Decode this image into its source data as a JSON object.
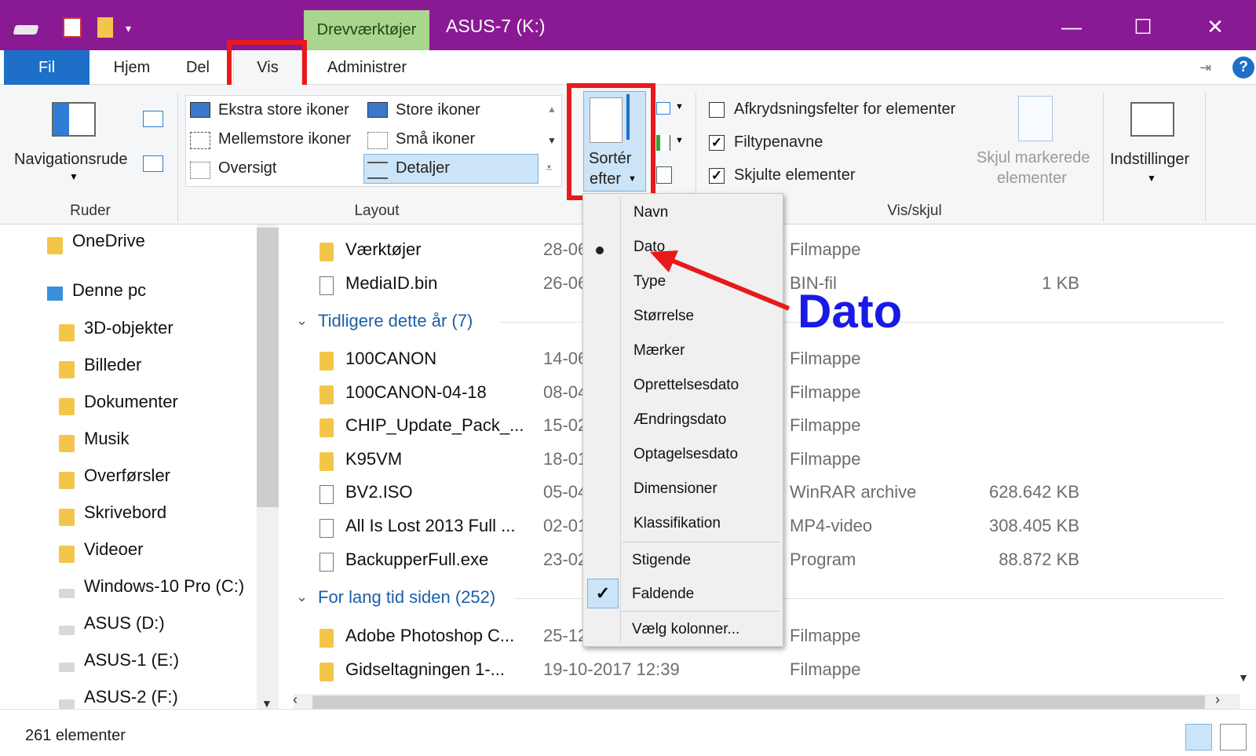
{
  "titlebar": {
    "title": "ASUS-7 (K:)",
    "context_tab": "Drevværktøjer",
    "minimize": "—",
    "maximize": "☐",
    "close": "✕",
    "accent": "#8a1a94"
  },
  "tabs": [
    "Fil",
    "Hjem",
    "Del",
    "Vis",
    "Administrer"
  ],
  "ribbon": {
    "ruder": {
      "nav_pane": "Navigationsrude",
      "group": "Ruder"
    },
    "layout": {
      "options": [
        "Ekstra store ikoner",
        "Store ikoner",
        "Mellemstore ikoner",
        "Små ikoner",
        "Oversigt",
        "Detaljer"
      ],
      "selected": "Detaljer",
      "group": "Layout"
    },
    "sort": {
      "line1": "Sortér",
      "line2": "efter"
    },
    "visskjul": {
      "checkboxes": [
        {
          "label": "Afkrydsningsfelter for elementer",
          "checked": false
        },
        {
          "label": "Filtypenavne",
          "checked": true
        },
        {
          "label": "Skjulte elementer",
          "checked": true
        }
      ],
      "hide_selected_1": "Skjul markerede",
      "hide_selected_2": "elementer",
      "group": "Vis/skjul"
    },
    "settings": "Indstillinger"
  },
  "nav": {
    "items": [
      "OneDrive",
      "Denne pc",
      "3D-objekter",
      "Billeder",
      "Dokumenter",
      "Musik",
      "Overførsler",
      "Skrivebord",
      "Videoer",
      "Windows-10 Pro (C:)",
      "ASUS (D:)",
      "ASUS-1 (E:)",
      "ASUS-2 (F:)"
    ]
  },
  "files": {
    "top_rows": [
      {
        "name": "Værktøjer",
        "date": "28-06",
        "type": "Filmappe",
        "size": ""
      },
      {
        "name": "MediaID.bin",
        "date": "26-06",
        "type": "BIN-fil",
        "size": "1 KB"
      }
    ],
    "group1": "Tidligere dette år (7)",
    "group1_rows": [
      {
        "name": "100CANON",
        "date": "14-06",
        "type": "Filmappe",
        "size": ""
      },
      {
        "name": "100CANON-04-18",
        "date": "08-04",
        "type": "Filmappe",
        "size": ""
      },
      {
        "name": "CHIP_Update_Pack_...",
        "date": "15-02",
        "type": "Filmappe",
        "size": ""
      },
      {
        "name": "K95VM",
        "date": "18-01",
        "type": "Filmappe",
        "size": ""
      },
      {
        "name": "BV2.ISO",
        "date": "05-04",
        "type": "WinRAR archive",
        "size": "628.642 KB"
      },
      {
        "name": "All Is Lost 2013 Full ...",
        "date": "02-01",
        "type": "MP4-video",
        "size": "308.405 KB"
      },
      {
        "name": "BackupperFull.exe",
        "date": "23-02",
        "type": "Program",
        "size": "88.872 KB"
      }
    ],
    "group2": "For lang tid siden (252)",
    "group2_rows": [
      {
        "name": "Adobe Photoshop C...",
        "date": "25-12",
        "type": "Filmappe",
        "size": ""
      },
      {
        "name": "Gidseltagningen 1-...",
        "date": "19-10-2017 12:39",
        "type": "Filmappe",
        "size": ""
      }
    ]
  },
  "menu": {
    "items": [
      "Navn",
      "Dato",
      "Type",
      "Størrelse",
      "Mærker",
      "Oprettelsesdato",
      "Ændringsdato",
      "Optagelsesdato",
      "Dimensioner",
      "Klassifikation"
    ],
    "selected": "Dato",
    "order": [
      "Stigende",
      "Faldende"
    ],
    "order_selected": "Faldende",
    "choose_columns": "Vælg kolonner..."
  },
  "annotation": {
    "text": "Dato",
    "color": "#1a1ae6",
    "arrow_color": "#e8191c"
  },
  "status": {
    "count": "261 elementer"
  }
}
